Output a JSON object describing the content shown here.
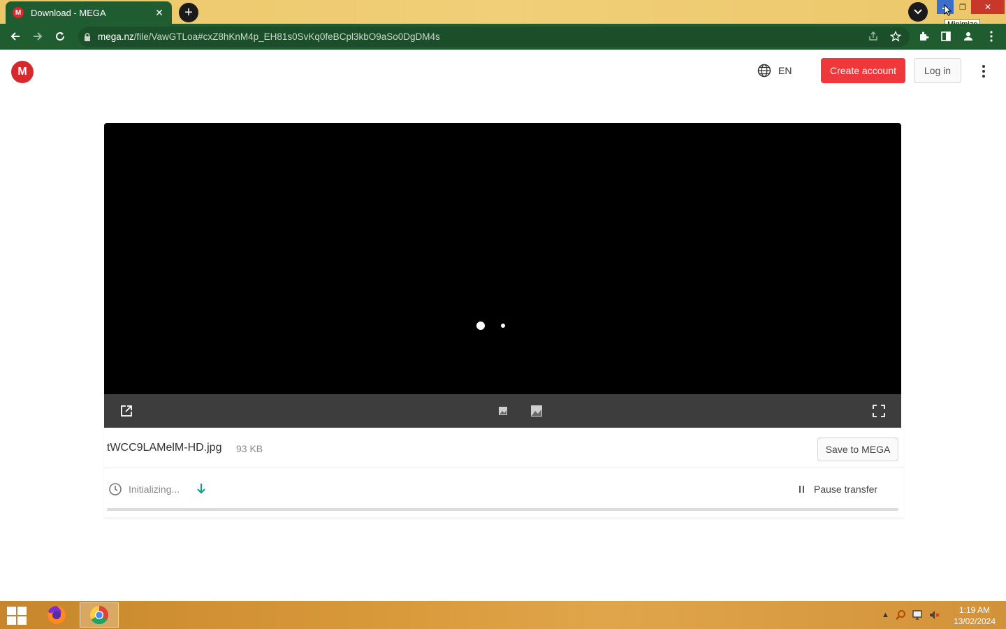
{
  "browser": {
    "tab": {
      "title": "Download - MEGA",
      "favicon_letter": "M"
    },
    "new_tab_label": "+",
    "url_domain": "mega.nz",
    "url_path": "/file/VawGTLoa#cxZ8hKnM4p_EH81s0SvKq0feBCpl3kbO9aSo0DgDM4s",
    "window_controls": {
      "close_glyph": "✕",
      "maximize_glyph": "❐"
    },
    "tooltip": "Minimize"
  },
  "header": {
    "logo_letter": "M",
    "language": "EN",
    "create_account": "Create account",
    "log_in": "Log in"
  },
  "viewer": {
    "loading_indicator": "two white dots"
  },
  "file": {
    "name": "tWCC9LAMelM-HD.jpg",
    "size": "93 KB",
    "save_button": "Save to MEGA",
    "status": "Initializing...",
    "pause_button": "Pause transfer",
    "progress": 0
  },
  "taskbar": {
    "apps": [
      "firefox-icon",
      "chrome-icon"
    ],
    "active_app": "chrome-icon",
    "time": "1:19 AM",
    "date": "13/02/2024"
  },
  "colors": {
    "accent_red": "#f0373a",
    "browser_green": "#1f5c30",
    "tabstrip_yellow": "#ecc76a",
    "download_arrow": "#00a382"
  }
}
